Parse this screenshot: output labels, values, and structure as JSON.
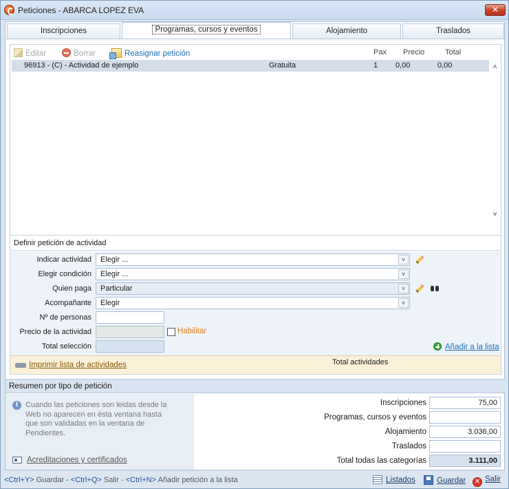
{
  "window": {
    "title": "Peticiones - ABARCA LOPEZ EVA",
    "close_glyph": "✕"
  },
  "tabs": [
    {
      "label": "Inscripciones",
      "active": false
    },
    {
      "label": "Programas, cursos y eventos",
      "active": true
    },
    {
      "label": "Alojamiento",
      "active": false
    },
    {
      "label": "Traslados",
      "active": false
    }
  ],
  "toolbar": {
    "edit_label": "Editar",
    "delete_label": "Borrar",
    "reassign_label": "Reasignar petición"
  },
  "list": {
    "columns": {
      "pax": "Pax",
      "price": "Precio",
      "total": "Total"
    },
    "rows": [
      {
        "description": "96913 - (C) - Actividad de ejemplo",
        "type": "Gratuita",
        "pax": "1",
        "price": "0,00",
        "total": "0,00"
      }
    ]
  },
  "define_section": {
    "title": "Definir petición de actividad",
    "fields": {
      "activity": {
        "label": "Indicar actividad",
        "value": "Elegir ..."
      },
      "condition": {
        "label": "Elegir condición",
        "value": "Elegir ..."
      },
      "payer": {
        "label": "Quien paga",
        "value": "Particular"
      },
      "companion": {
        "label": "Acompañante",
        "value": "Elegir"
      },
      "num_people": {
        "label": "Nº de personas",
        "value": ""
      },
      "activity_price": {
        "label": "Precio de la actividad",
        "value": ""
      },
      "enable_label": "Habilitar",
      "selection_total": {
        "label": "Total selección",
        "value": ""
      }
    },
    "add_to_list": "Añadir a la lista"
  },
  "print_bar": {
    "print_link": "Imprimir lista de actividades",
    "total_activities": "Total actividades"
  },
  "summary": {
    "title": "Resumen por tipo de petición",
    "info_text": "Cuando las peticiones son leidas desde la Web no aparecen en ésta ventana hasta que son validadas en la ventana de Pendientes.",
    "cert_link": "Acreditaciones y certificados",
    "rows": [
      {
        "label": "Inscripciones",
        "value": "75,00"
      },
      {
        "label": "Programas, cursos y eventos",
        "value": ""
      },
      {
        "label": "Alojamiento",
        "value": "3.036,00"
      },
      {
        "label": "Traslados",
        "value": ""
      },
      {
        "label": "Total todas las categorías",
        "value": "3.111,00"
      }
    ]
  },
  "statusbar": {
    "k1": "<Ctrl+Y>",
    "t1": " Guardar - ",
    "k2": "<Ctrl+Q>",
    "t2": " Salir - ",
    "k3": "<Ctrl+N>",
    "t3": " Añadir petición a la lista",
    "list_label": "Listados",
    "save_label": "Guardar",
    "exit_label": "Salir"
  },
  "colors": {
    "accent_link": "#1e6fb5",
    "enable_orange": "#e07a1a",
    "selected_row": "#d4dde8"
  }
}
